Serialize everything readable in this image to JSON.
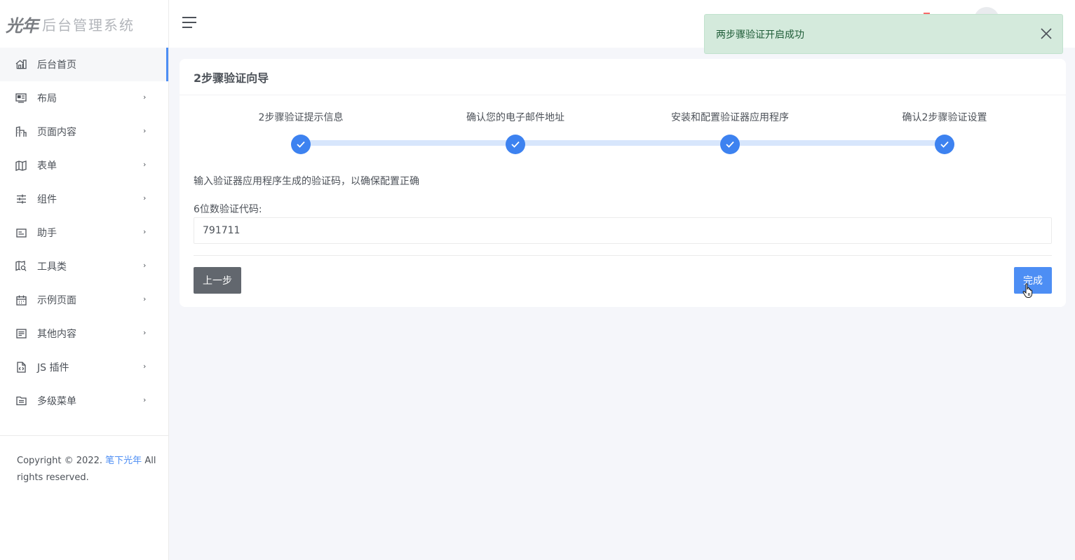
{
  "app": {
    "logo_mark": "光年",
    "logo_text": "后台管理系统"
  },
  "sidebar": {
    "items": [
      {
        "label": "后台首页",
        "icon": "home-icon"
      },
      {
        "label": "布局",
        "icon": "layout-icon"
      },
      {
        "label": "页面内容",
        "icon": "buildings-icon"
      },
      {
        "label": "表单",
        "icon": "map-icon"
      },
      {
        "label": "组件",
        "icon": "sliders-icon"
      },
      {
        "label": "助手",
        "icon": "card-icon"
      },
      {
        "label": "工具类",
        "icon": "map-search-icon"
      },
      {
        "label": "示例页面",
        "icon": "calendar-icon"
      },
      {
        "label": "其他内容",
        "icon": "list-box-icon"
      },
      {
        "label": "JS 插件",
        "icon": "code-file-icon"
      },
      {
        "label": "多级菜单",
        "icon": "folder-icon"
      }
    ],
    "arrow": "›",
    "copyright_prefix": "Copyright © 2022.",
    "copyright_link": "笔下光年",
    "copyright_suffix": "All rights reserved."
  },
  "alert": {
    "text": "两步骤验证开启成功"
  },
  "card": {
    "title": "2步骤验证向导",
    "steps": [
      {
        "label": "2步骤验证提示信息"
      },
      {
        "label": "确认您的电子邮件地址"
      },
      {
        "label": "安装和配置验证器应用程序"
      },
      {
        "label": "确认2步骤验证设置"
      }
    ],
    "instruction": "输入验证器应用程序生成的验证码，以确保配置正确",
    "field_label": "6位数验证代码:",
    "code_value": "791711",
    "prev_label": "上一步",
    "finish_label": "完成"
  },
  "colors": {
    "accent": "#4d8ef4",
    "step_dot": "#3d82f0",
    "step_line": "#d7e6fc",
    "alert_bg": "#d4eadc",
    "prev_button": "#62676e"
  }
}
